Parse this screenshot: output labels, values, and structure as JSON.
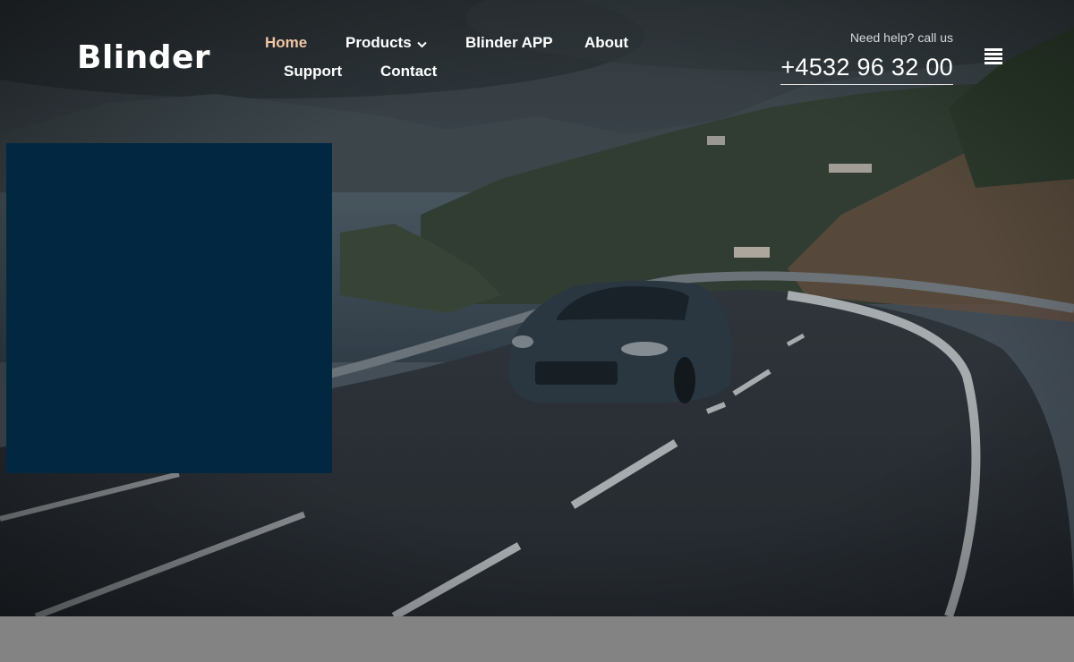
{
  "brand": {
    "name": "Blinder"
  },
  "nav": {
    "items": [
      {
        "label": "Home",
        "active": true
      },
      {
        "label": "Products",
        "has_dropdown": true,
        "icon": "chevron-down-icon"
      },
      {
        "label": "Blinder APP"
      },
      {
        "label": "About"
      },
      {
        "label": "Support"
      },
      {
        "label": "Contact"
      }
    ]
  },
  "contact": {
    "help_text": "Need help? call us",
    "phone": "+4532 96 32 00"
  },
  "menu": {
    "icon": "hamburger-menu-icon"
  },
  "hero": {
    "image": "sports-car-on-coastal-mountain-road"
  },
  "colors": {
    "accent_active": "#f0c7a3",
    "panel": "#012840",
    "footer_band": "#838383",
    "text_primary": "#ffffff"
  }
}
